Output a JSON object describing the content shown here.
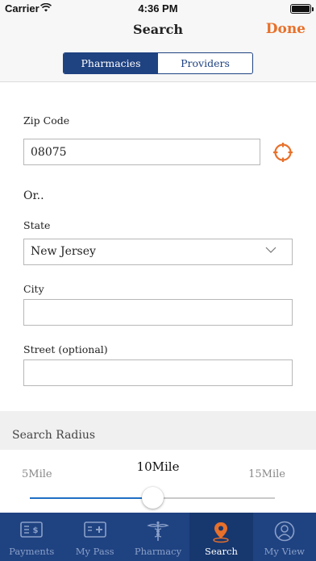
{
  "status": {
    "carrier": "Carrier",
    "time": "4:36 PM"
  },
  "nav": {
    "title": "Search",
    "done_label": "Done"
  },
  "segments": [
    {
      "label": "Pharmacies",
      "active": true
    },
    {
      "label": "Providers",
      "active": false
    }
  ],
  "form": {
    "zip_label": "Zip Code",
    "zip_value": "08075",
    "or_text": "Or..",
    "state_label": "State",
    "state_value": "New Jersey",
    "city_label": "City",
    "city_value": "",
    "street_label": "Street (optional)",
    "street_value": ""
  },
  "radius": {
    "section_title": "Search Radius",
    "min_label": "5Mile",
    "max_label": "15Mile",
    "value_label": "10Mile",
    "value": 10,
    "min": 5,
    "max": 15
  },
  "tabs": [
    {
      "label": "Payments",
      "icon": "payments-icon",
      "active": false
    },
    {
      "label": "My Pass",
      "icon": "id-card-icon",
      "active": false
    },
    {
      "label": "Pharmacy",
      "icon": "caduceus-icon",
      "active": false
    },
    {
      "label": "Search",
      "icon": "location-pin-icon",
      "active": true
    },
    {
      "label": "My View",
      "icon": "user-icon",
      "active": false
    }
  ],
  "colors": {
    "brand_navy": "#1f4281",
    "accent_orange": "#e8702a",
    "slider_fill": "#1f6fc4"
  }
}
